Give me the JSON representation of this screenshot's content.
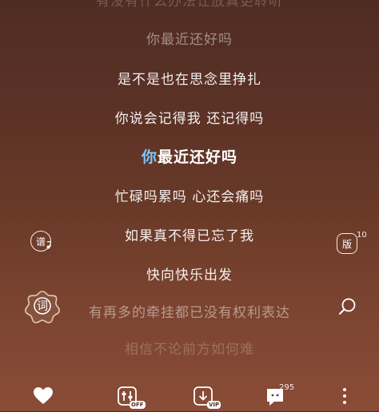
{
  "lyrics": {
    "lines": [
      "有没有什么办法让放真更聆听",
      "你最近还好吗",
      "是不是也在思念里挣扎",
      "你说会记得我 还记得吗",
      "如果真不得已忘了我",
      "忙碌吗累吗 心还会痛吗",
      "快向快乐出发",
      "有再多的牵挂都已没有权利表达",
      "相信不论前方如何难"
    ],
    "current": {
      "highlight": "你",
      "rest": "最近还好吗"
    }
  },
  "side": {
    "score_label": "谱",
    "lyric_label": "词",
    "version_label": "版",
    "version_count": "10"
  },
  "bottom": {
    "effects_badge": "OFF",
    "download_badge": "VIP",
    "comment_count": "295"
  },
  "colors": {
    "highlight": "#7fc6ff"
  }
}
